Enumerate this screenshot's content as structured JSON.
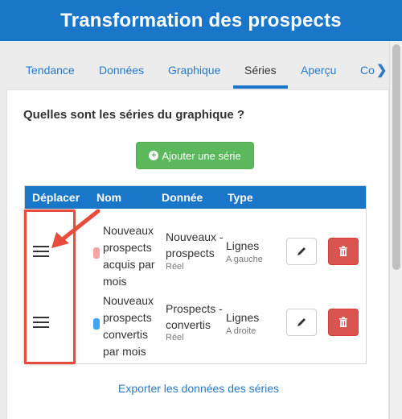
{
  "header": {
    "title": "Transformation des prospects"
  },
  "tabs": [
    {
      "label": "Tendance"
    },
    {
      "label": "Données"
    },
    {
      "label": "Graphique"
    },
    {
      "label": "Séries"
    },
    {
      "label": "Aperçu"
    },
    {
      "label": "Co"
    }
  ],
  "active_tab": "Séries",
  "panel": {
    "question": "Quelles sont les séries du graphique ?",
    "add_button_label": "Ajouter une série",
    "export_link": "Exporter les données des séries"
  },
  "table": {
    "headers": [
      "Déplacer",
      "Nom",
      "Donnée",
      "Type"
    ],
    "rows": [
      {
        "color": "#f5a3a3",
        "name": "Nouveaux prospects acquis par mois",
        "data": "Nouveaux - prospects",
        "data_sub": "Réel",
        "type": "Lignes",
        "type_sub": "A gauche"
      },
      {
        "color": "#3ea3f0",
        "name": "Nouveaux prospects convertis par mois",
        "data": "Prospects - convertis",
        "data_sub": "Réel",
        "type": "Lignes",
        "type_sub": "A droite"
      }
    ]
  },
  "colors": {
    "header_bg": "#1976c9",
    "add_button": "#5cb85c",
    "delete_button": "#d9534f",
    "annotation": "#e74c3c"
  }
}
